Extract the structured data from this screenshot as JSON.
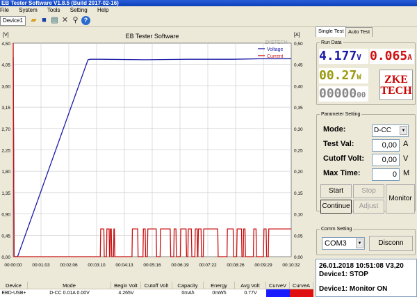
{
  "window": {
    "title": "EB Tester Software V1.8.5 (Build 2017-02-16)"
  },
  "menu": [
    "File",
    "System",
    "Tools",
    "Setting",
    "Help"
  ],
  "toolbar": {
    "device_tab": "Device1",
    "icons": [
      "folder-icon",
      "save-icon",
      "chart-icon",
      "tools-icon",
      "search-icon",
      "help-icon"
    ]
  },
  "tabs": {
    "single": "Single Test",
    "auto": "Auto Test"
  },
  "run_data": {
    "group_label": "Run Data",
    "voltage": "4.177",
    "voltage_unit": "V",
    "current": "0.065",
    "current_unit": "A",
    "power": "00.27",
    "power_unit": "W",
    "capacity": "00000",
    "capacity_unit": "00",
    "logo_line1": "ZKE",
    "logo_line2": "TECH"
  },
  "params": {
    "group_label": "Parameter Setting",
    "mode_label": "Mode:",
    "mode_value": "D-CC",
    "testval_label": "Test Val:",
    "testval_value": "0,00",
    "testval_unit": "A",
    "cutoff_label": "Cutoff Volt:",
    "cutoff_value": "0,00",
    "cutoff_unit": "V",
    "maxtime_label": "Max Time:",
    "maxtime_value": "0",
    "maxtime_unit": "M"
  },
  "buttons": {
    "start": "Start",
    "stop": "Stop",
    "continue": "Continue",
    "adjust": "Adjust",
    "monitor": "Monitor"
  },
  "comm": {
    "group_label": "Comm Setting",
    "port": "COM3",
    "disconnect": "Disconn"
  },
  "log": {
    "line1": "26.01.2018 10:51:08  V3,20",
    "line2": "Device1: STOP",
    "line3": "Device1: Monitor ON"
  },
  "table": {
    "headers": [
      "Device",
      "Mode",
      "Begin Volt",
      "Cutoff Volt",
      "Capacity",
      "Energy",
      "Avg Volt",
      "CurveV",
      "CurveA"
    ],
    "row": [
      "EBD-USB+",
      "D-CC 0.01A 0.00V",
      "4.265V",
      "",
      "0mAh",
      "0mWh",
      "0.77V",
      "",
      ""
    ],
    "curve_colors": [
      "#1a1aff",
      "#e01010"
    ]
  },
  "chart_data": {
    "type": "line",
    "title": "EB Tester Software",
    "ylabel_left": "[V]",
    "ylabel_right": "[A]",
    "watermark": "ZKETECH",
    "x_ticks": [
      "00:00:00",
      "00:01:03",
      "00:02:06",
      "00:03:10",
      "00:04:13",
      "00:05:16",
      "00:06:19",
      "00:07:22",
      "00:08:26",
      "00:09:29",
      "00:10:32"
    ],
    "y_left_ticks": [
      "4,50",
      "4,05",
      "3,60",
      "3,15",
      "2,70",
      "2,25",
      "1,80",
      "1,35",
      "0,90",
      "0,45",
      "0,00"
    ],
    "y_right_ticks": [
      "0,50",
      "0,45",
      "0,40",
      "0,35",
      "0,30",
      "0,25",
      "0,20",
      "0,15",
      "0,10",
      "0,05",
      "0,00"
    ],
    "ylim_left": [
      0,
      4.5
    ],
    "ylim_right": [
      0,
      0.5
    ],
    "xlim_seconds": [
      0,
      632
    ],
    "series": [
      {
        "name": "Voltage",
        "color": "#1a1aa8",
        "axis": "left",
        "x": [
          0,
          2,
          3,
          10,
          170,
          175,
          200,
          300,
          400,
          500,
          560,
          632
        ],
        "y": [
          4.2,
          0.0,
          0.0,
          0.0,
          4.15,
          4.16,
          4.16,
          4.15,
          4.16,
          4.16,
          4.17,
          4.17
        ]
      },
      {
        "name": "Current",
        "color": "#c81010",
        "axis": "right",
        "x": [
          0,
          1,
          2,
          198,
          199,
          206,
          207,
          212,
          213,
          218,
          219,
          220,
          221,
          223,
          224,
          228,
          229,
          230,
          231,
          270,
          271,
          283,
          284,
          295,
          296,
          300,
          301,
          305,
          306,
          325,
          326,
          334,
          335,
          357,
          358,
          365,
          366,
          370,
          371,
          380,
          381,
          393,
          394,
          397,
          398,
          405,
          406,
          413,
          414,
          418,
          419,
          420,
          421,
          427,
          428,
          432,
          433,
          465,
          466,
          486,
          487,
          500,
          501,
          508,
          509,
          519,
          520,
          523,
          524,
          527,
          528,
          546,
          547,
          552,
          553,
          569,
          570,
          575,
          576,
          580,
          581,
          586,
          587,
          632
        ],
        "y": [
          0.5,
          0.25,
          0.0,
          0.0,
          0.065,
          0.065,
          0.0,
          0.0,
          0.065,
          0.065,
          0.0,
          0.0,
          0.065,
          0.065,
          0.0,
          0.0,
          0.065,
          0.065,
          0.0,
          0.0,
          0.065,
          0.065,
          0.0,
          0.0,
          0.065,
          0.065,
          0.0,
          0.0,
          0.065,
          0.065,
          0.0,
          0.0,
          0.065,
          0.065,
          0.0,
          0.0,
          0.065,
          0.065,
          0.0,
          0.0,
          0.065,
          0.065,
          0.0,
          0.0,
          0.065,
          0.065,
          0.0,
          0.0,
          0.065,
          0.065,
          0.0,
          0.0,
          0.065,
          0.065,
          0.0,
          0.0,
          0.065,
          0.065,
          0.0,
          0.0,
          0.065,
          0.065,
          0.0,
          0.0,
          0.065,
          0.065,
          0.0,
          0.0,
          0.065,
          0.065,
          0.0,
          0.0,
          0.065,
          0.065,
          0.0,
          0.0,
          0.065,
          0.065,
          0.0,
          0.0,
          0.065,
          0.065,
          0.065,
          0.065
        ]
      }
    ],
    "grid": true,
    "legend": "top-right"
  }
}
